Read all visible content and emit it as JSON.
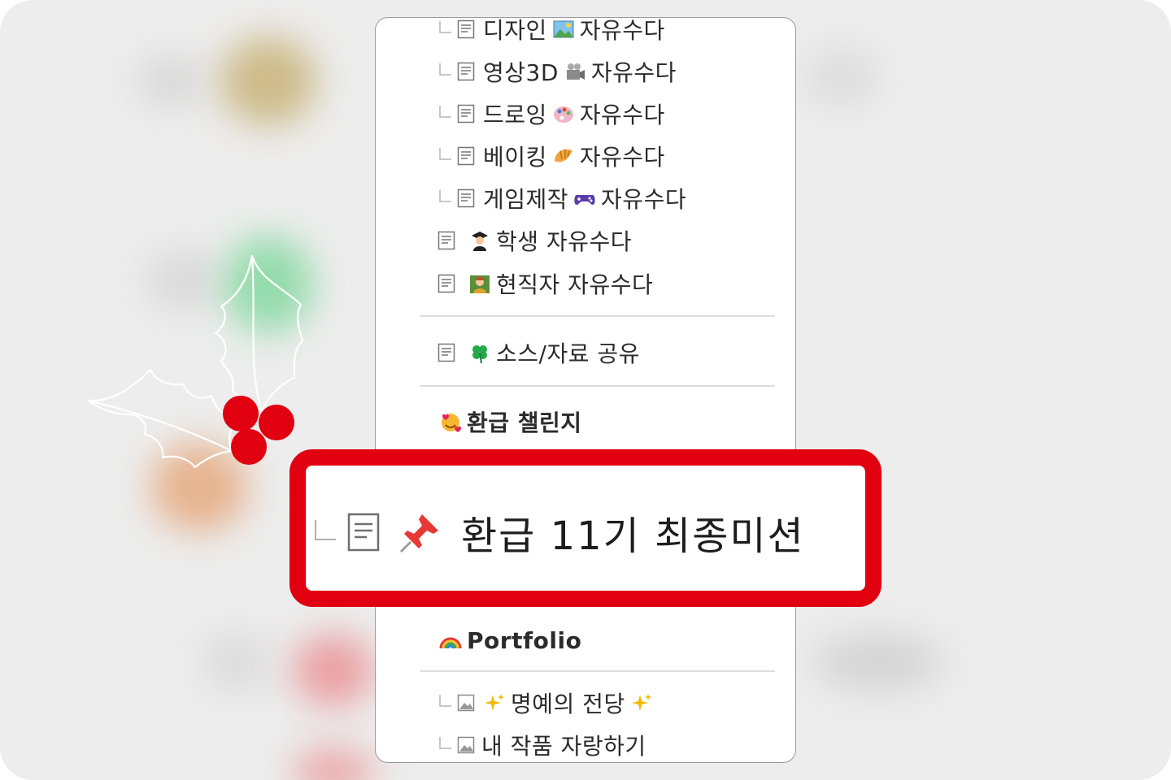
{
  "menu": {
    "sub_items": [
      {
        "label": "디자인",
        "emoji": "picture-icon",
        "suffix": "자유수다"
      },
      {
        "label": "영상3D",
        "emoji": "camera-icon",
        "suffix": "자유수다"
      },
      {
        "label": "드로잉",
        "emoji": "palette-icon",
        "suffix": "자유수다"
      },
      {
        "label": "베이킹",
        "emoji": "croissant-icon",
        "suffix": "자유수다"
      },
      {
        "label": "게임제작",
        "emoji": "gamepad-icon",
        "suffix": "자유수다"
      }
    ],
    "top_items": [
      {
        "label": "학생 자유수다",
        "emoji": "student-icon"
      },
      {
        "label": "현직자 자유수다",
        "emoji": "worker-icon"
      }
    ],
    "resource_item": {
      "label": "소스/자료 공유",
      "emoji": "clover-icon"
    },
    "refund_section": {
      "label": "환급 챌린지",
      "emoji": "hearts-face-icon"
    },
    "highlighted_item": {
      "label": "환급 11기 최종미션",
      "emoji": "pushpin-icon"
    },
    "portfolio_section": {
      "label": "Portfolio",
      "emoji": "rainbow-icon"
    },
    "portfolio_items": [
      {
        "label": "명예의 전당",
        "emoji": "sparkles-icon"
      },
      {
        "label": "내 작품 자랑하기"
      }
    ]
  },
  "colors": {
    "highlight_border": "#e00010",
    "berry": "#e00010",
    "panel_border": "#9a9a9a"
  }
}
